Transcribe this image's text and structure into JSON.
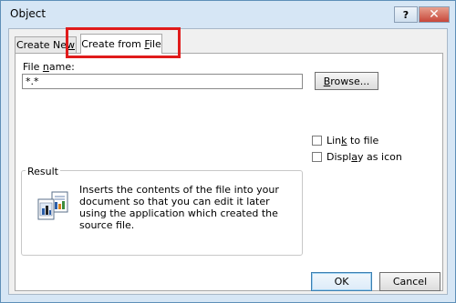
{
  "window": {
    "title": "Object",
    "help_label": "?",
    "close_label": "✕"
  },
  "tabs": [
    {
      "label_pre": "Create Ne",
      "label_key": "w",
      "label_post": ""
    },
    {
      "label_pre": "Create from ",
      "label_key": "F",
      "label_post": "ile"
    }
  ],
  "file": {
    "label_pre": "File ",
    "label_key": "n",
    "label_post": "ame:",
    "value": "*.*"
  },
  "browse": {
    "label_pre": "",
    "label_key": "B",
    "label_post": "rowse..."
  },
  "options": {
    "link": {
      "label_pre": "Lin",
      "label_key": "k",
      "label_post": " to file",
      "checked": false
    },
    "icon": {
      "label_pre": "Displ",
      "label_key": "a",
      "label_post": "y as icon",
      "checked": false
    }
  },
  "result": {
    "label": "Result",
    "text": "Inserts the contents of the file into your document so that you can edit it later using the application which created the source file."
  },
  "buttons": {
    "ok": "OK",
    "cancel": "Cancel"
  },
  "colors": {
    "highlight": "#e01b1b",
    "close": "#c7473a",
    "titlebar": "#d6e6f5"
  },
  "icons": {
    "result": "insert-file-icon",
    "close": "close-icon",
    "help": "help-icon"
  }
}
